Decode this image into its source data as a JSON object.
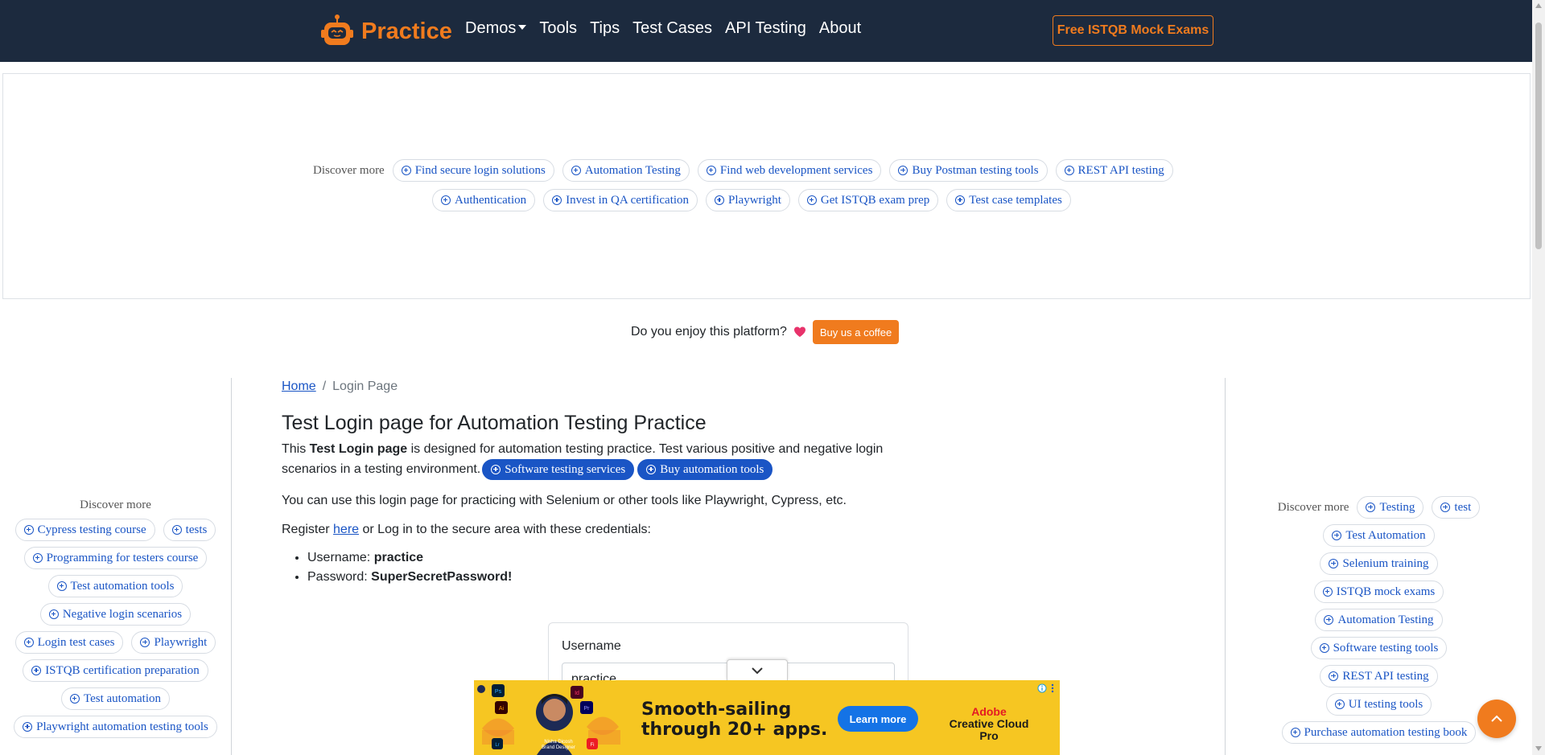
{
  "navbar": {
    "brand": "Practice",
    "links": [
      "Demos",
      "Tools",
      "Tips",
      "Test Cases",
      "API Testing",
      "About"
    ],
    "cta": "Free ISTQB Mock Exams"
  },
  "top_discover": {
    "label": "Discover more",
    "row1": [
      "Find secure login solutions",
      "Automation Testing",
      "Find web development services",
      "Buy Postman testing tools",
      "REST API testing"
    ],
    "row2": [
      "Authentication",
      "Invest in QA certification",
      "Playwright",
      "Get ISTQB exam prep",
      "Test case templates"
    ]
  },
  "coffee": {
    "text": "Do you enjoy this platform?",
    "button": "Buy us a coffee"
  },
  "left_discover": {
    "label": "Discover more",
    "rows": [
      [
        "Cypress testing course",
        "tests"
      ],
      [
        "Programming for testers course"
      ],
      [
        "Test automation tools"
      ],
      [
        "Negative login scenarios"
      ],
      [
        "Login test cases",
        "Playwright"
      ],
      [
        "ISTQB certification preparation"
      ],
      [
        "Test automation"
      ],
      [
        "Playwright automation testing tools"
      ]
    ]
  },
  "right_discover": {
    "label": "Discover more",
    "first_row": [
      "Testing",
      "test"
    ],
    "rows": [
      "Test Automation",
      "Selenium training",
      "ISTQB mock exams",
      "Automation Testing",
      "Software testing tools",
      "REST API testing",
      "UI testing tools",
      "Purchase automation testing book"
    ]
  },
  "main": {
    "breadcrumb": {
      "home": "Home",
      "separator": "/",
      "current": "Login Page"
    },
    "title": "Test Login page for Automation Testing Practice",
    "intro_prefix": "This ",
    "intro_bold": "Test Login page",
    "intro_rest": " is designed for automation testing practice. Test various positive and negative login scenarios in a testing environment.",
    "intro_chips": [
      "Software testing services",
      "Buy automation tools"
    ],
    "tools_text": "You can use this login page for practicing with Selenium or other tools like Playwright, Cypress, etc.",
    "register_prefix": "Register ",
    "register_link": "here",
    "register_suffix": " or Log in to the secure area with these credentials:",
    "credentials": [
      {
        "label": "Username: ",
        "value": "practice"
      },
      {
        "label": "Password: ",
        "value": "SuperSecretPassword!"
      }
    ]
  },
  "login_form": {
    "username_label": "Username",
    "username_value": "practice"
  },
  "ad": {
    "headline_line1": "Smooth-sailing",
    "headline_line2": "through 20+ apps.",
    "button": "Learn more",
    "brand_line1": "Adobe",
    "brand_line2": "Creative Cloud Pro",
    "person_name": "Nisha Dicosh",
    "person_role": "Brand Designer"
  },
  "colors": {
    "navbar_bg": "#1c2a3e",
    "accent_orange": "#f07b1e",
    "link_blue": "#1a55c5",
    "ad_yellow": "#f6c622"
  }
}
